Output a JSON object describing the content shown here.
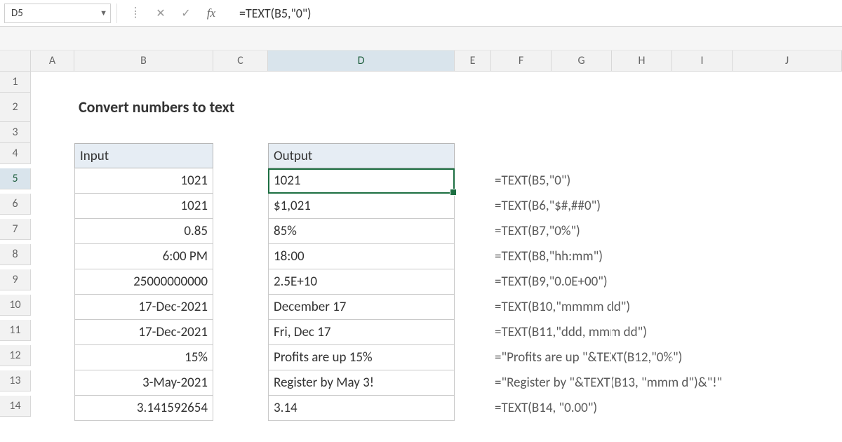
{
  "name_box": "D5",
  "formula_bar": "=TEXT(B5,\"0\")",
  "columns": [
    "A",
    "B",
    "C",
    "D",
    "E",
    "F",
    "G",
    "H",
    "I",
    "J"
  ],
  "rows": [
    "1",
    "2",
    "3",
    "4",
    "5",
    "6",
    "7",
    "8",
    "9",
    "10",
    "11",
    "12",
    "13",
    "14"
  ],
  "active_col": "D",
  "active_row": "5",
  "title": "Convert numbers to text",
  "headers": {
    "input": "Input",
    "output": "Output"
  },
  "data_rows": [
    {
      "input": "1021",
      "output": "1021",
      "formula": "=TEXT(B5,\"0\")"
    },
    {
      "input": "1021",
      "output": "$1,021",
      "formula": "=TEXT(B6,\"$#,##0\")"
    },
    {
      "input": "0.85",
      "output": "85%",
      "formula": "=TEXT(B7,\"0%\")"
    },
    {
      "input": "6:00 PM",
      "output": "18:00",
      "formula": "=TEXT(B8,\"hh:mm\")"
    },
    {
      "input": "25000000000",
      "output": "2.5E+10",
      "formula": "=TEXT(B9,\"0.0E+00\")"
    },
    {
      "input": "17-Dec-2021",
      "output": "December 17",
      "formula": "=TEXT(B10,\"mmmm dd\")"
    },
    {
      "input": "17-Dec-2021",
      "output": "Fri, Dec 17",
      "formula": "=TEXT(B11,\"ddd, mmm dd\")"
    },
    {
      "input": "15%",
      "output": "Profits are up 15%",
      "formula": "=\"Profits are up \"&TEXT(B12,\"0%\")"
    },
    {
      "input": "3-May-2021",
      "output": "Register by May 3!",
      "formula": "=\"Register by \"&TEXT(B13, \"mmm d\")&\"!\""
    },
    {
      "input": "3.141592654",
      "output": "3.14",
      "formula": "=TEXT(B14, \"0.00\")"
    }
  ]
}
